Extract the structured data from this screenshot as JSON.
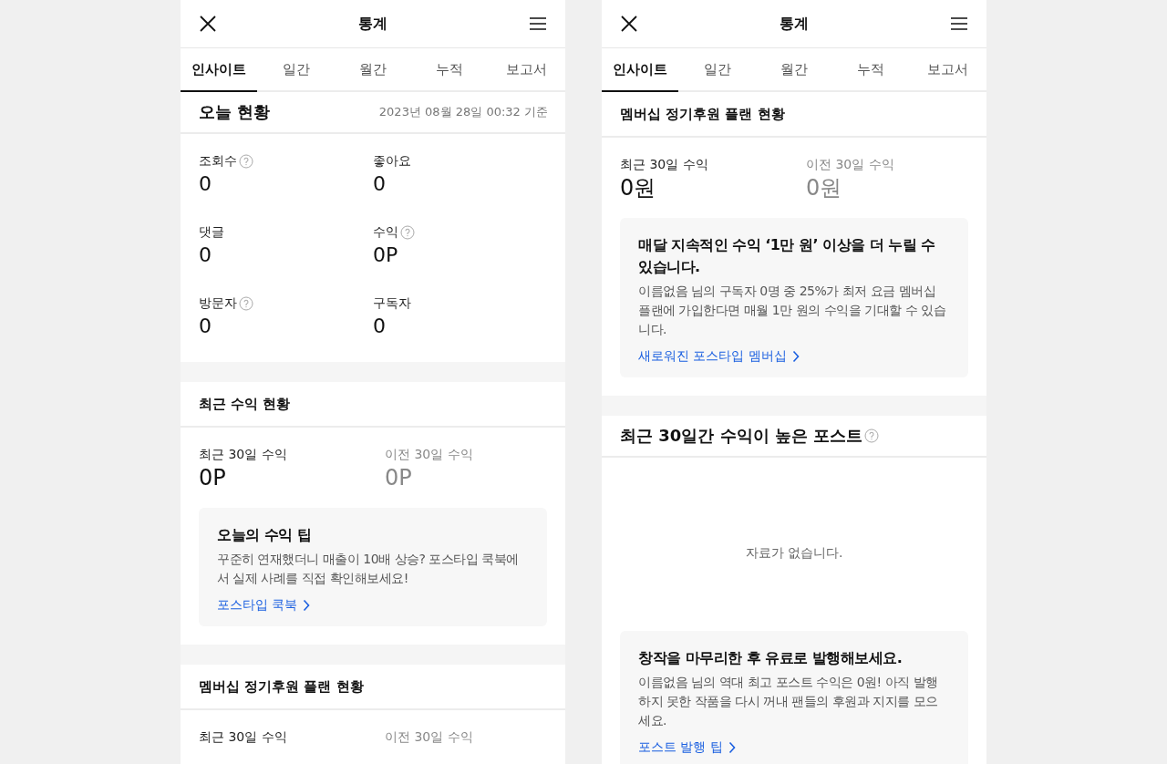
{
  "screens": [
    {
      "header": {
        "title": "통계"
      },
      "tabs": [
        {
          "label": "인사이트",
          "selected": true
        },
        {
          "label": "일간",
          "selected": false
        },
        {
          "label": "월간",
          "selected": false
        },
        {
          "label": "누적",
          "selected": false
        },
        {
          "label": "보고서",
          "selected": false
        }
      ],
      "sections": [
        {
          "kind": "today",
          "title": "오늘 현황",
          "timestamp": "2023년 08월 28일 00:32 기준",
          "stats": [
            {
              "label": "조회수",
              "help": true,
              "value": "0"
            },
            {
              "label": "좋아요",
              "help": false,
              "value": "0"
            },
            {
              "label": "댓글",
              "help": false,
              "value": "0"
            },
            {
              "label": "수익",
              "help": true,
              "value": "0P"
            },
            {
              "label": "방문자",
              "help": true,
              "value": "0"
            },
            {
              "label": "구독자",
              "help": false,
              "value": "0"
            }
          ]
        },
        {
          "kind": "income",
          "title": "최근 수익 현황",
          "stats": [
            {
              "label": "최근 30일 수익",
              "muted": false,
              "value": "0P"
            },
            {
              "label": "이전 30일 수익",
              "muted": true,
              "value": "0P"
            }
          ],
          "tip": {
            "title": "오늘의 수익 팁",
            "body": "꾸준히 연재했더니 매출이 10배 상승? 포스타입 쿡북에서 실제 사례를 직접 확인해보세요!",
            "link": "포스타입 쿡북"
          }
        },
        {
          "kind": "income",
          "title": "멤버십 정기후원 플랜 현황",
          "stats": [
            {
              "label": "최근 30일 수익",
              "muted": false
            },
            {
              "label": "이전 30일 수익",
              "muted": true
            }
          ]
        }
      ]
    },
    {
      "header": {
        "title": "통계"
      },
      "tabs": [
        {
          "label": "인사이트",
          "selected": true
        },
        {
          "label": "일간",
          "selected": false
        },
        {
          "label": "월간",
          "selected": false
        },
        {
          "label": "누적",
          "selected": false
        },
        {
          "label": "보고서",
          "selected": false
        }
      ],
      "sections": [
        {
          "kind": "income",
          "title": "멤버십 정기후원 플랜 현황",
          "stats": [
            {
              "label": "최근 30일 수익",
              "muted": false,
              "value": "0원"
            },
            {
              "label": "이전 30일 수익",
              "muted": true,
              "value": "0원"
            }
          ],
          "tip": {
            "title": "매달 지속적인 수익 ‘1만 원’ 이상을 더 누릴 수 있습니다.",
            "body": "이름없음 님의 구독자 0명 중 25%가 최저 요금 멤버십 플랜에 가입한다면 매월 1만 원의 수익을 기대할 수 있습니다.",
            "link": "새로워진 포스타입 멤버십"
          }
        },
        {
          "kind": "top_posts",
          "title": "최근 30일간 수익이 높은 포스트",
          "help": true,
          "empty_message": "자료가 없습니다.",
          "tip": {
            "title": "창작을 마무리한 후 유료로 발행해보세요.",
            "body": "이름없음 님의 역대 최고 포스트 수익은 0원! 아직 발행하지 못한 작품을 다시 꺼내 팬들의 후원과 지지를 모으세요.",
            "link": "포스트 발행 팁"
          }
        }
      ]
    }
  ]
}
